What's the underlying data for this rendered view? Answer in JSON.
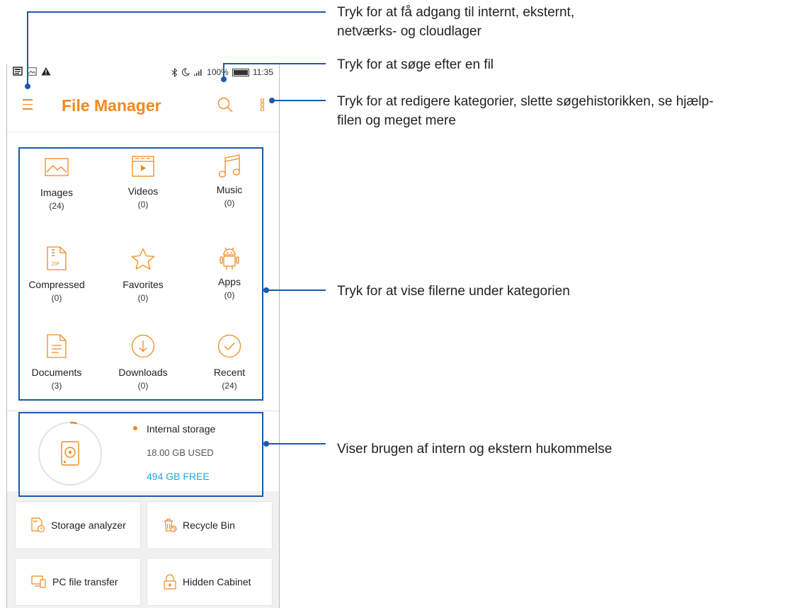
{
  "statusbar": {
    "battery_pct": "100%",
    "time": "11:35"
  },
  "appbar": {
    "title": "File Manager"
  },
  "categories": [
    {
      "label": "Images",
      "count": "(24)",
      "icon": "image-icon"
    },
    {
      "label": "Videos",
      "count": "(0)",
      "icon": "video-icon"
    },
    {
      "label": "Music",
      "count": "(0)",
      "icon": "music-note-icon"
    },
    {
      "label": "Compressed",
      "count": "(0)",
      "icon": "zip-file-icon",
      "icon_text": "ZIP"
    },
    {
      "label": "Favorites",
      "count": "(0)",
      "icon": "star-icon"
    },
    {
      "label": "Apps",
      "count": "(0)",
      "icon": "android-icon"
    },
    {
      "label": "Documents",
      "count": "(3)",
      "icon": "document-icon"
    },
    {
      "label": "Downloads",
      "count": "(0)",
      "icon": "download-icon"
    },
    {
      "label": "Recent",
      "count": "(24)",
      "icon": "check-circle-icon"
    }
  ],
  "storage": {
    "name": "Internal storage",
    "used": "18.00 GB USED",
    "free": "494 GB FREE",
    "used_fraction": 0.035
  },
  "tools": [
    {
      "label": "Storage analyzer",
      "icon": "storage-analyzer-icon"
    },
    {
      "label": "Recycle Bin",
      "icon": "recycle-bin-icon"
    },
    {
      "label": "PC file transfer",
      "icon": "pc-transfer-icon"
    },
    {
      "label": "Hidden Cabinet",
      "icon": "lock-icon"
    }
  ],
  "callouts": {
    "menu": [
      "Tryk for at få adgang til internt, eksternt,",
      "netværks- og cloudlager"
    ],
    "search": "Tryk for at søge efter en fil",
    "more": [
      "Tryk for at redigere kategorier, slette søgehistorikken, se hjælp-",
      "filen og meget mere"
    ],
    "categories": "Tryk for at vise filerne under kategorien",
    "storage": "Viser brugen af intern og ekstern hukommelse"
  },
  "colors": {
    "accent": "#f08a1c",
    "free": "#1ca8e8",
    "annotation": "#1a5aa8"
  }
}
